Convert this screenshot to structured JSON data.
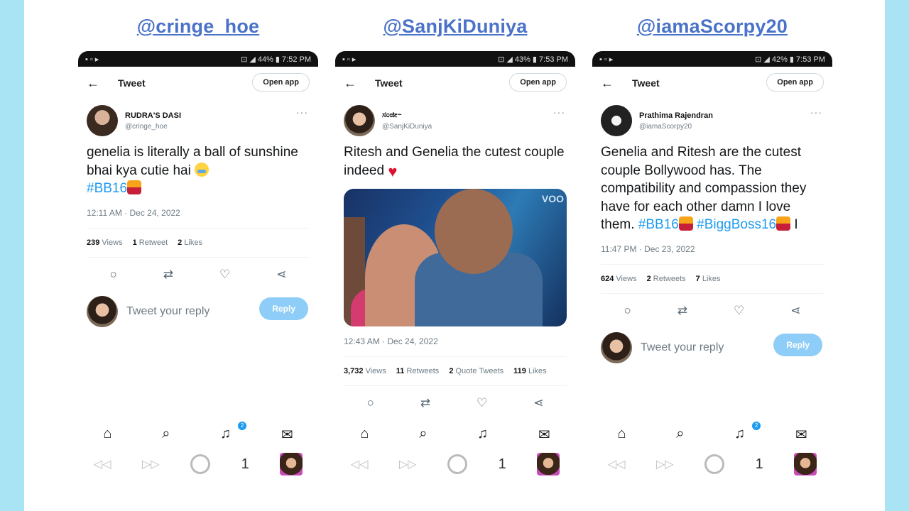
{
  "columns": [
    {
      "handle": "@cringe_hoe",
      "status_right": "⊡ ◢ 44% ▮ 7:52 PM",
      "topbar": {
        "title": "Tweet",
        "open_app": "Open app"
      },
      "author": {
        "display_name": "RUDRA'S DASI",
        "username": "@cringe_hoe"
      },
      "text_parts": [
        "genelia is literally a ball of sunshine bhai kya cutie hai ",
        "#BB16"
      ],
      "meta": "12:11 AM · Dec 24, 2022",
      "stats": [
        {
          "count": "239",
          "label": "Views"
        },
        {
          "count": "1",
          "label": "Retweet"
        },
        {
          "count": "2",
          "label": "Likes"
        }
      ],
      "reply": {
        "placeholder": "Tweet your reply",
        "button": "Reply"
      },
      "badge": "2"
    },
    {
      "handle": "@SanjKiDuniya",
      "status_right": "⊡ ◢ 43% ▮ 7:53 PM",
      "topbar": {
        "title": "Tweet",
        "open_app": "Open app"
      },
      "author": {
        "display_name": "ಸಂಜೀ~",
        "username": "@SanjKiDuniya"
      },
      "text_parts": [
        "Ritesh and Genelia the cutest couple indeed "
      ],
      "image_label": "VOO",
      "meta": "12:43 AM · Dec 24, 2022",
      "stats": [
        {
          "count": "3,732",
          "label": "Views"
        },
        {
          "count": "11",
          "label": "Retweets"
        },
        {
          "count": "2",
          "label": "Quote Tweets"
        },
        {
          "count": "119",
          "label": "Likes"
        }
      ]
    },
    {
      "handle": "@iamaScorpy20",
      "status_right": "⊡ ◢ 42% ▮ 7:53 PM",
      "topbar": {
        "title": "Tweet",
        "open_app": "Open app"
      },
      "author": {
        "display_name": "Prathima Rajendran",
        "username": "@iamaScorpy20"
      },
      "text_parts": [
        "Genelia and Ritesh are the cutest couple Bollywood has. The compatibility and compassion they have for each other damn I love them. ",
        "#BB16",
        "#BiggBoss16",
        " I"
      ],
      "meta": "11:47 PM · Dec 23, 2022",
      "stats": [
        {
          "count": "624",
          "label": "Views"
        },
        {
          "count": "2",
          "label": "Retweets"
        },
        {
          "count": "7",
          "label": "Likes"
        }
      ],
      "reply": {
        "placeholder": "Tweet your reply",
        "button": "Reply"
      },
      "badge": "2"
    }
  ],
  "sysbar": {
    "count": "1"
  },
  "icons": [
    "back-arrow-icon",
    "reply-icon",
    "retweet-icon",
    "like-icon",
    "share-icon",
    "home-icon",
    "search-icon",
    "bell-icon",
    "mail-icon"
  ]
}
